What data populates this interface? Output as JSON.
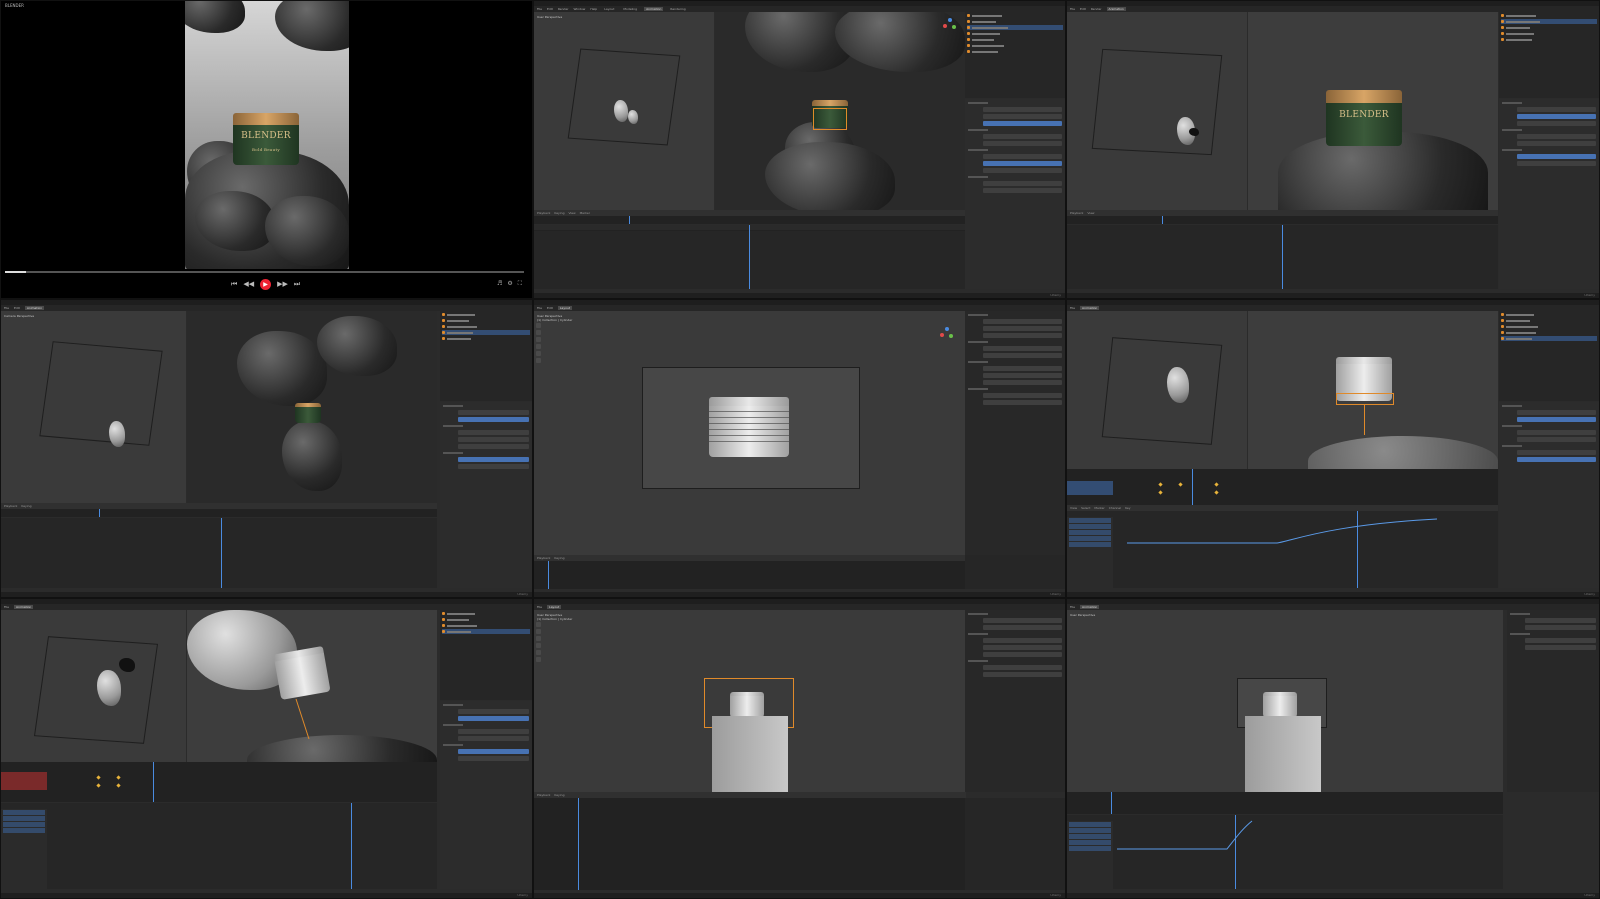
{
  "player": {
    "title": "BLENDER",
    "jar_brand": "BLENDER",
    "jar_sub": "Bold Beauty",
    "time_label": "",
    "progress": 0.04
  },
  "blender": {
    "menu": [
      "File",
      "Edit",
      "Render",
      "Window",
      "Help"
    ],
    "workspaces": [
      "Layout",
      "Modeling",
      "Sculpting",
      "UV Editing",
      "Texture Paint",
      "Shading",
      "Animation",
      "Rendering",
      "Compositing",
      "Geometry Nodes",
      "Scripting"
    ],
    "active_workspace": "Animation",
    "viewport_menu": [
      "View",
      "Select",
      "Add",
      "Object"
    ],
    "timeline_menu": [
      "Playback",
      "Keying",
      "View",
      "Marker"
    ],
    "graph_menu": [
      "View",
      "Select",
      "Marker",
      "Channel",
      "Key"
    ],
    "camera_info": [
      "Camera Perspective",
      "(1) Collection | Rocks"
    ],
    "user_info": [
      "User Perspective",
      "(1) Collection | Cylinder"
    ],
    "status_brand": "Udemy"
  },
  "colors": {
    "accent_blue": "#4772b3",
    "selection_orange": "#e08a2a",
    "key_yellow": "#e8b33a",
    "curve_blue": "#5a9ae8"
  }
}
